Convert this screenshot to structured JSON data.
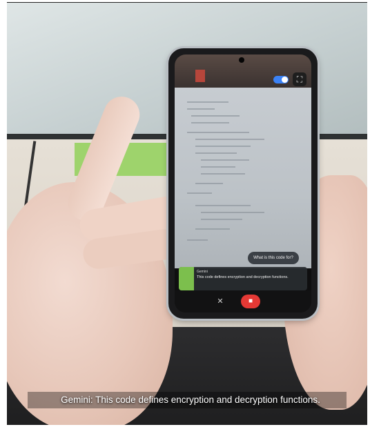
{
  "phone_ui": {
    "question_bubble": "What is this code for?",
    "answer_label": "Gemini",
    "answer_text": "This code defines encryption and decryption functions.",
    "toggle_on": true,
    "accent_blue": "#3b82f6",
    "record_red": "#e53935",
    "icons": {
      "expand": "expand-icon",
      "mute": "mute-icon",
      "record": "video-camera-icon"
    }
  },
  "caption": {
    "text": "Gemini: This code defines encryption and decryption functions."
  }
}
